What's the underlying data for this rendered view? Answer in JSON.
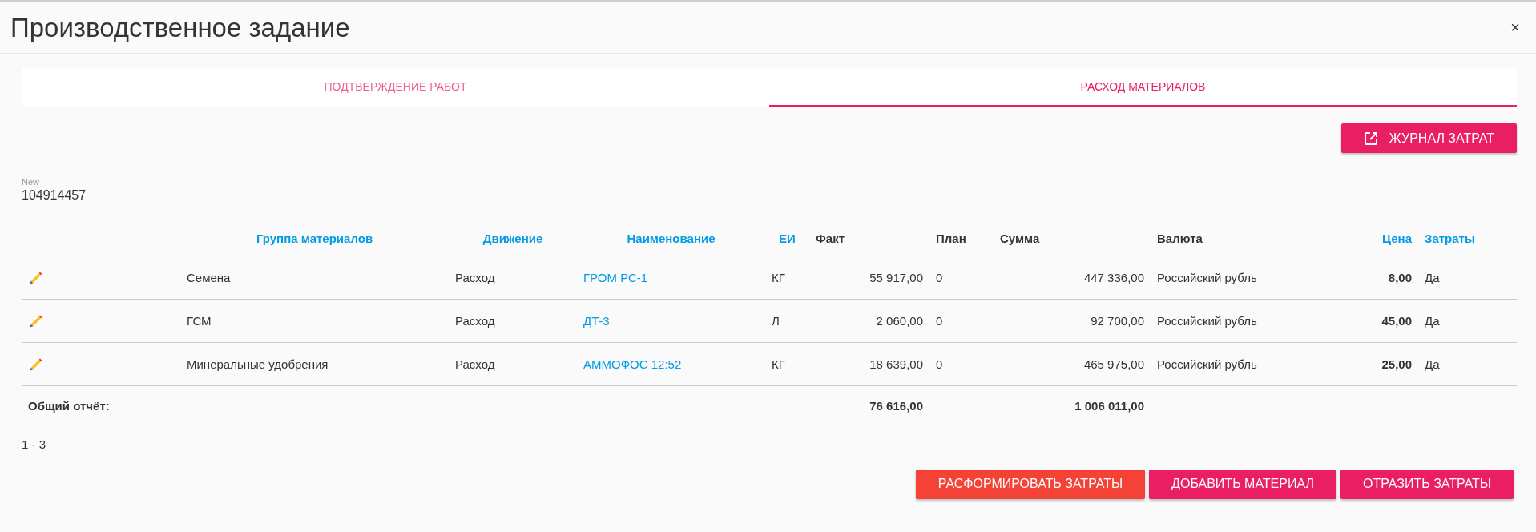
{
  "window": {
    "title": "Производственное задание",
    "close": "×"
  },
  "tabs": [
    {
      "label": "ПОДТВЕРЖДЕНИЕ РАБОТ",
      "selected": false
    },
    {
      "label": "РАСХОД МАТЕРИАЛОВ",
      "selected": true
    }
  ],
  "journal_button": {
    "label": "ЖУРНАЛ ЗАТРАТ"
  },
  "record": {
    "status": "New",
    "number": "104914457"
  },
  "table": {
    "columns": [
      {
        "label": "Группа материалов",
        "sortable": true
      },
      {
        "label": "Движение",
        "sortable": true
      },
      {
        "label": "Наименование",
        "sortable": true
      },
      {
        "label": "ЕИ",
        "sortable": true
      },
      {
        "label": "Факт",
        "sortable": false
      },
      {
        "label": "План",
        "sortable": false
      },
      {
        "label": "Сумма",
        "sortable": false
      },
      {
        "label": "Валюта",
        "sortable": false
      },
      {
        "label": "Цена",
        "sortable": true
      },
      {
        "label": "Затраты",
        "sortable": true
      }
    ],
    "rows": [
      {
        "group": "Семена",
        "movement": "Расход",
        "name": "ГРОМ РС-1",
        "unit": "КГ",
        "fact": "55 917,00",
        "plan": "0",
        "sum": "447 336,00",
        "currency": "Российский рубль",
        "price": "8,00",
        "costs": "Да"
      },
      {
        "group": "ГСМ",
        "movement": "Расход",
        "name": "ДТ-3",
        "unit": "Л",
        "fact": "2 060,00",
        "plan": "0",
        "sum": "92 700,00",
        "currency": "Российский рубль",
        "price": "45,00",
        "costs": "Да"
      },
      {
        "group": "Минеральные удобрения",
        "movement": "Расход",
        "name": "АММОФОС 12:52",
        "unit": "КГ",
        "fact": "18 639,00",
        "plan": "0",
        "sum": "465 975,00",
        "currency": "Российский рубль",
        "price": "25,00",
        "costs": "Да"
      }
    ],
    "totals": {
      "label": "Общий отчёт:",
      "fact": "76 616,00",
      "sum": "1 006 011,00"
    }
  },
  "pagination": "1 - 3",
  "actions": [
    {
      "label": "РАСФОРМИРОВАТЬ ЗАТРАТЫ",
      "kind": "warning"
    },
    {
      "label": "ДОБАВИТЬ МАТЕРИАЛ",
      "kind": "primary"
    },
    {
      "label": "ОТРАЗИТЬ ЗАТРАТЫ",
      "kind": "primary"
    }
  ]
}
